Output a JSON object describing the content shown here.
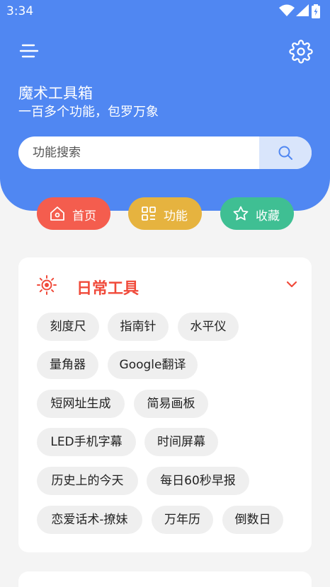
{
  "status_bar": {
    "time": "3:34"
  },
  "header": {
    "title": "魔术工具箱",
    "subtitle": "一百多个功能，包罗万象",
    "menu_icon": "menu-icon",
    "settings_icon": "gear-icon"
  },
  "search": {
    "placeholder": "功能搜索",
    "value": ""
  },
  "nav_pills": [
    {
      "label": "首页",
      "icon": "home-icon",
      "color": "#f45d4e"
    },
    {
      "label": "功能",
      "icon": "grid-icon",
      "color": "#e6b33f"
    },
    {
      "label": "收藏",
      "icon": "star-icon",
      "color": "#3fbf93"
    }
  ],
  "category": {
    "title": "日常工具",
    "icon": "sun-icon",
    "accent": "#f04a3a",
    "tools": [
      "刻度尺",
      "指南针",
      "水平仪",
      "量角器",
      "Google翻译",
      "短网址生成",
      "简易画板",
      "LED手机字幕",
      "时间屏幕",
      "历史上的今天",
      "每日60秒早报",
      "恋爱话术-撩妹",
      "万年历",
      "倒数日"
    ]
  },
  "colors": {
    "primary": "#5087f2",
    "background": "#f4f4f4"
  }
}
